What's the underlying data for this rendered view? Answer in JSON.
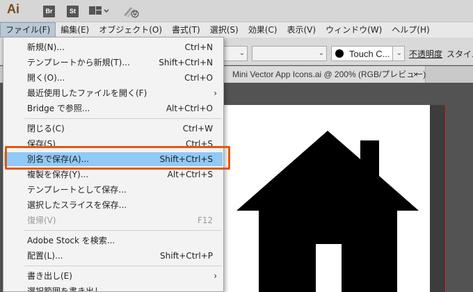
{
  "app": {
    "logo": "Ai",
    "bridge_badge": "Br",
    "stock_badge": "St",
    "layout_chevron": "⌄",
    "icons": [
      "layout-grid-icon",
      "workspace-sync-icon"
    ]
  },
  "menubar": [
    "ファイル(F)",
    "編集(E)",
    "オブジェクト(O)",
    "書式(T)",
    "選択(S)",
    "効果(C)",
    "表示(V)",
    "ウィンドウ(W)",
    "ヘルプ(H)"
  ],
  "control": {
    "brush": "Touch C...",
    "opacity_label": "不透明度",
    "style_label": "スタイル"
  },
  "document": {
    "tab_title": "Mini Vector App Icons.ai @ 200% (RGB/プレビュー)",
    "close_glyph": "×"
  },
  "file_menu": {
    "items": [
      {
        "label": "新規(N)...",
        "shortcut": "Ctrl+N"
      },
      {
        "label": "テンプレートから新規(T)...",
        "shortcut": "Shift+Ctrl+N"
      },
      {
        "label": "開く(O)...",
        "shortcut": "Ctrl+O"
      },
      {
        "label": "最近使用したファイルを開く(F)",
        "shortcut": "",
        "arrow": "›"
      },
      {
        "label": "Bridge で参照...",
        "shortcut": "Alt+Ctrl+O"
      },
      {
        "label": "閉じる(C)",
        "shortcut": "Ctrl+W"
      },
      {
        "label": "保存(S)",
        "shortcut": "Ctrl+S"
      },
      {
        "label": "別名で保存(A)...",
        "shortcut": "Shift+Ctrl+S"
      },
      {
        "label": "複製を保存(Y)...",
        "shortcut": "Alt+Ctrl+S"
      },
      {
        "label": "テンプレートとして保存...",
        "shortcut": ""
      },
      {
        "label": "選択したスライスを保存...",
        "shortcut": ""
      },
      {
        "label": "復帰(V)",
        "shortcut": "F12"
      },
      {
        "label": "Adobe Stock を検索...",
        "shortcut": ""
      },
      {
        "label": "配置(L)...",
        "shortcut": "Shift+Ctrl+P"
      },
      {
        "label": "書き出し(E)",
        "shortcut": "",
        "arrow": "›"
      },
      {
        "label": "選択範囲を書き出し...",
        "shortcut": ""
      }
    ],
    "highlighted_index": 7
  },
  "colors": {
    "highlight": "#91c9f7",
    "callout": "#e4570a",
    "bleed_guide": "#dd2222"
  }
}
